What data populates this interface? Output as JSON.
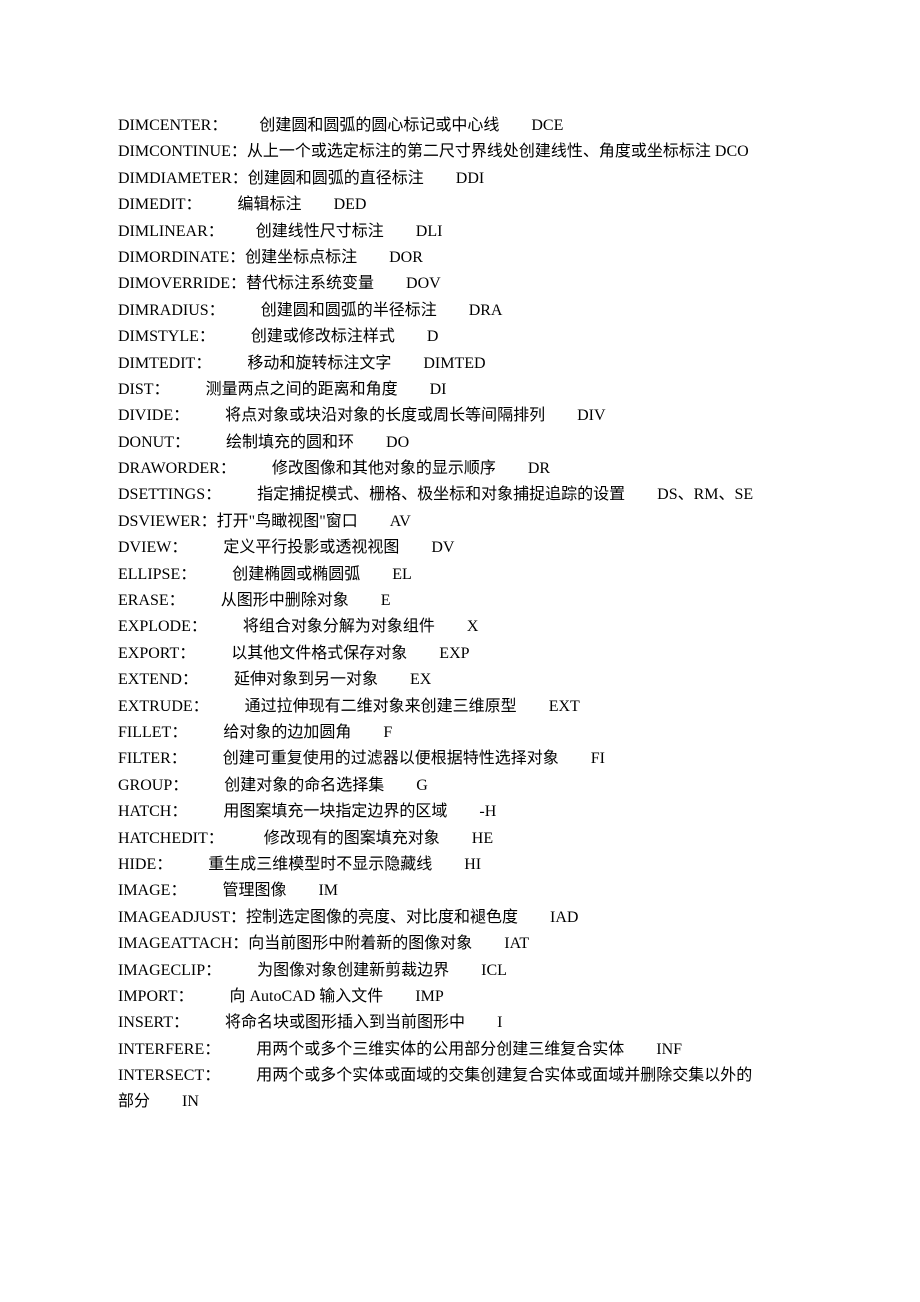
{
  "rows": [
    {
      "cmd": "DIMCENTER：",
      "desc": "创建圆和圆弧的圆心标记或中心线",
      "abbr": "DCE",
      "gap1": "        ",
      "gap2": "        "
    },
    {
      "cmd": "DIMCONTINUE：",
      "desc": "从上一个或选定标注的第二尺寸界线处创建线性、角度或坐标标注",
      "abbr": " DCO",
      "gap1": "",
      "gap2": ""
    },
    {
      "cmd": "DIMDIAMETER：",
      "desc": "创建圆和圆弧的直径标注",
      "abbr": "DDI",
      "gap1": "",
      "gap2": "        "
    },
    {
      "cmd": "DIMEDIT：",
      "desc": "编辑标注",
      "abbr": "DED",
      "gap1": "         ",
      "gap2": "        "
    },
    {
      "cmd": "DIMLINEAR：",
      "desc": "创建线性尺寸标注",
      "abbr": "DLI",
      "gap1": "        ",
      "gap2": "        "
    },
    {
      "cmd": "DIMORDINATE：",
      "desc": "创建坐标点标注",
      "abbr": "DOR",
      "gap1": "",
      "gap2": "        "
    },
    {
      "cmd": "DIMOVERRIDE：",
      "desc": "替代标注系统变量",
      "abbr": "DOV",
      "gap1": "",
      "gap2": "        "
    },
    {
      "cmd": "DIMRADIUS：",
      "desc": "创建圆和圆弧的半径标注",
      "abbr": "DRA",
      "gap1": "         ",
      "gap2": "        "
    },
    {
      "cmd": "DIMSTYLE：",
      "desc": "创建或修改标注样式",
      "abbr": "D",
      "gap1": "         ",
      "gap2": "        "
    },
    {
      "cmd": "DIMTEDIT：",
      "desc": "移动和旋转标注文字",
      "abbr": "DIMTED",
      "gap1": "         ",
      "gap2": "        "
    },
    {
      "cmd": "DIST：",
      "desc": "测量两点之间的距离和角度",
      "abbr": "DI",
      "gap1": "         ",
      "gap2": "        "
    },
    {
      "cmd": "DIVIDE：",
      "desc": "将点对象或块沿对象的长度或周长等间隔排列",
      "abbr": "DIV",
      "gap1": "         ",
      "gap2": "        "
    },
    {
      "cmd": "DONUT：",
      "desc": "绘制填充的圆和环",
      "abbr": "DO",
      "gap1": "         ",
      "gap2": "        "
    },
    {
      "cmd": "DRAWORDER：",
      "desc": "修改图像和其他对象的显示顺序",
      "abbr": "DR",
      "gap1": "         ",
      "gap2": "        "
    },
    {
      "cmd": "DSETTINGS：",
      "desc": "指定捕捉模式、栅格、极坐标和对象捕捉追踪的设置",
      "abbr": "DS、RM、SE",
      "gap1": "         ",
      "gap2": "        "
    },
    {
      "cmd": "DSVIEWER：",
      "desc": "打开\"鸟瞰视图\"窗口",
      "abbr": "AV",
      "gap1": "",
      "gap2": "        "
    },
    {
      "cmd": "DVIEW：",
      "desc": "定义平行投影或透视视图",
      "abbr": "DV",
      "gap1": "         ",
      "gap2": "        "
    },
    {
      "cmd": "ELLIPSE：",
      "desc": "创建椭圆或椭圆弧",
      "abbr": "EL",
      "gap1": "         ",
      "gap2": "        "
    },
    {
      "cmd": "ERASE：",
      "desc": "从图形中删除对象",
      "abbr": "E",
      "gap1": "         ",
      "gap2": "        "
    },
    {
      "cmd": "EXPLODE：",
      "desc": "将组合对象分解为对象组件",
      "abbr": "X",
      "gap1": "         ",
      "gap2": "        "
    },
    {
      "cmd": "EXPORT：",
      "desc": "以其他文件格式保存对象",
      "abbr": "EXP",
      "gap1": "         ",
      "gap2": "        "
    },
    {
      "cmd": "EXTEND：",
      "desc": "延伸对象到另一对象",
      "abbr": "EX",
      "gap1": "         ",
      "gap2": "        "
    },
    {
      "cmd": "EXTRUDE：",
      "desc": "通过拉伸现有二维对象来创建三维原型",
      "abbr": "EXT",
      "gap1": "         ",
      "gap2": "        "
    },
    {
      "cmd": "FILLET：",
      "desc": "给对象的边加圆角",
      "abbr": "F",
      "gap1": "         ",
      "gap2": "        "
    },
    {
      "cmd": "FILTER：",
      "desc": "创建可重复使用的过滤器以便根据特性选择对象",
      "abbr": "FI",
      "gap1": "         ",
      "gap2": "        "
    },
    {
      "cmd": "GROUP：",
      "desc": "创建对象的命名选择集",
      "abbr": "G",
      "gap1": "         ",
      "gap2": "        "
    },
    {
      "cmd": "HATCH：",
      "desc": "用图案填充一块指定边界的区域",
      "abbr": "-H",
      "gap1": "         ",
      "gap2": "        "
    },
    {
      "cmd": "HATCHEDIT：",
      "desc": "修改现有的图案填充对象",
      "abbr": "HE",
      "gap1": "          ",
      "gap2": "        "
    },
    {
      "cmd": "HIDE：",
      "desc": "重生成三维模型时不显示隐藏线",
      "abbr": "HI",
      "gap1": "         ",
      "gap2": "        "
    },
    {
      "cmd": "IMAGE：",
      "desc": "管理图像",
      "abbr": "IM",
      "gap1": "         ",
      "gap2": "        "
    },
    {
      "cmd": "IMAGEADJUST：",
      "desc": "控制选定图像的亮度、对比度和褪色度",
      "abbr": "IAD",
      "gap1": "",
      "gap2": "        "
    },
    {
      "cmd": "IMAGEATTACH：",
      "desc": "向当前图形中附着新的图像对象",
      "abbr": "IAT",
      "gap1": "",
      "gap2": "        "
    },
    {
      "cmd": "IMAGECLIP：",
      "desc": "为图像对象创建新剪裁边界",
      "abbr": "ICL",
      "gap1": "         ",
      "gap2": "        "
    },
    {
      "cmd": "IMPORT：",
      "desc": "向 AutoCAD 输入文件",
      "abbr": "IMP",
      "gap1": "         ",
      "gap2": "        "
    },
    {
      "cmd": "INSERT：",
      "desc": "将命名块或图形插入到当前图形中",
      "abbr": "I",
      "gap1": "         ",
      "gap2": "        "
    },
    {
      "cmd": "INTERFERE：",
      "desc": "用两个或多个三维实体的公用部分创建三维复合实体",
      "abbr": "INF",
      "gap1": "         ",
      "gap2": "        "
    },
    {
      "cmd": "INTERSECT：",
      "desc": "用两个或多个实体或面域的交集创建复合实体或面域并删除交集以外的",
      "abbr": "",
      "gap1": "         ",
      "gap2": ""
    },
    {
      "cmd": "",
      "desc": "部分",
      "abbr": "IN",
      "gap1": "",
      "gap2": "        "
    }
  ]
}
